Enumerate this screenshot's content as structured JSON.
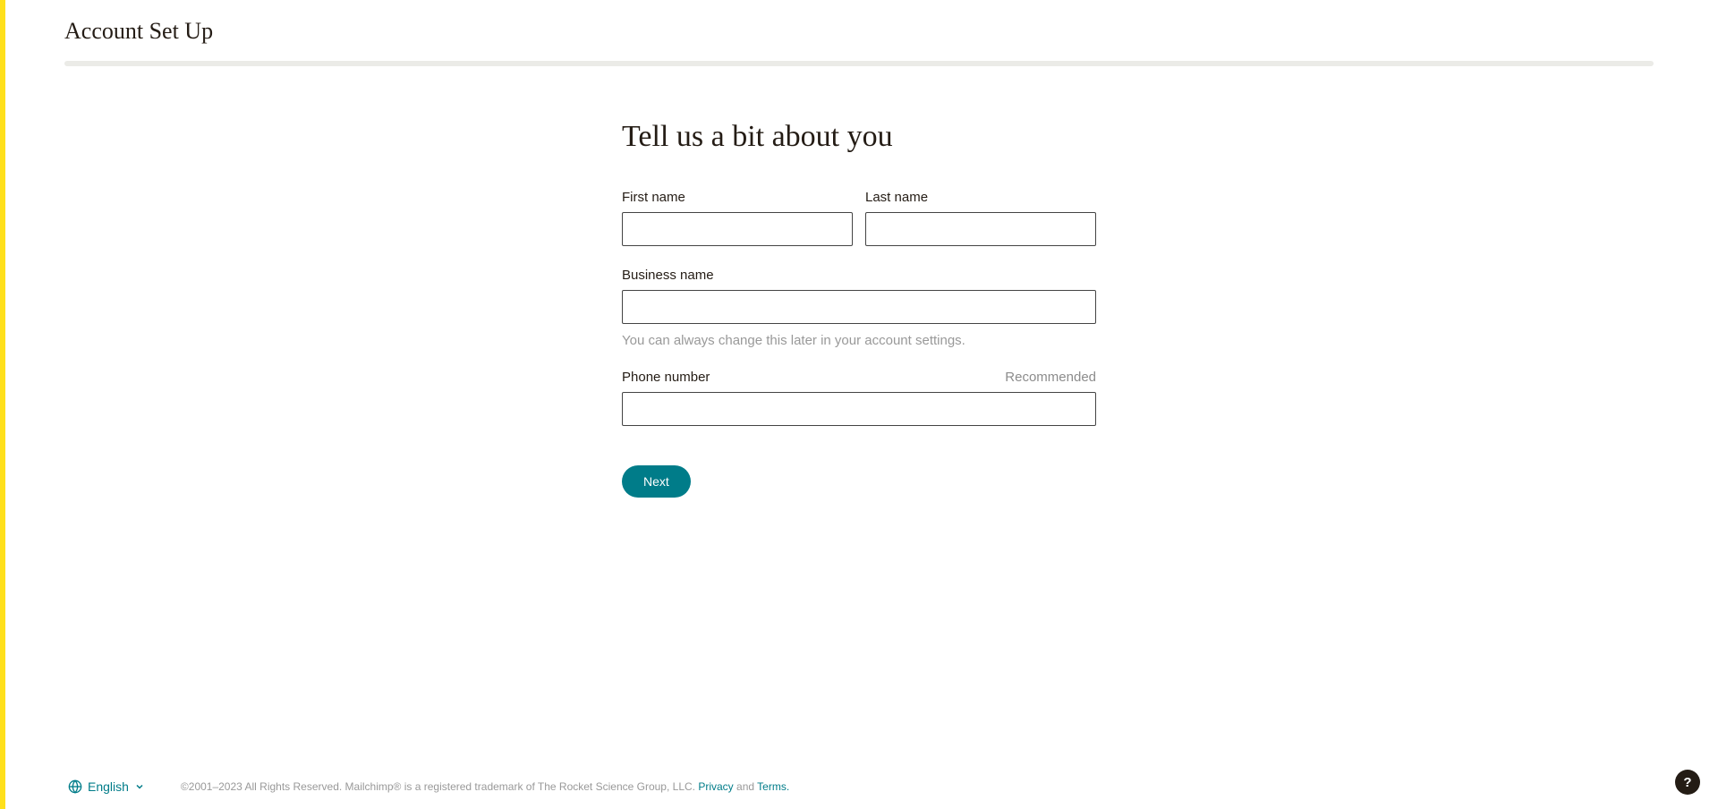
{
  "page": {
    "title": "Account Set Up"
  },
  "form": {
    "heading": "Tell us a bit about you",
    "firstName": {
      "label": "First name",
      "value": ""
    },
    "lastName": {
      "label": "Last name",
      "value": ""
    },
    "businessName": {
      "label": "Business name",
      "value": "",
      "helpText": "You can always change this later in your account settings."
    },
    "phoneNumber": {
      "label": "Phone number",
      "hint": "Recommended",
      "value": ""
    },
    "submitLabel": "Next"
  },
  "footer": {
    "language": "English",
    "copyright": "©2001–2023 All Rights Reserved. Mailchimp® is a registered trademark of The Rocket Science Group, LLC. ",
    "privacyLabel": "Privacy",
    "and": " and ",
    "termsLabel": "Terms."
  },
  "help": {
    "label": "?"
  }
}
